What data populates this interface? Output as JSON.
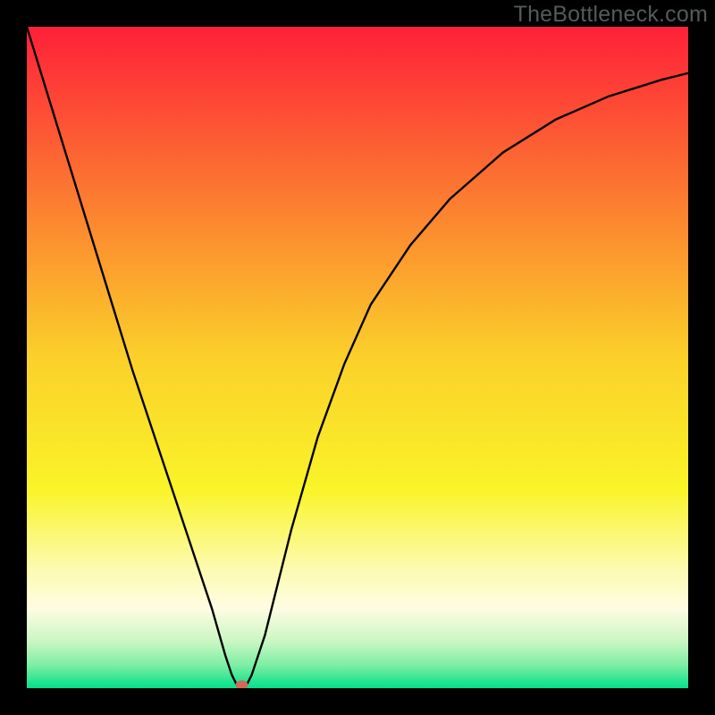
{
  "watermark": "TheBottleneck.com",
  "chart_data": {
    "type": "line",
    "title": "",
    "xlabel": "",
    "ylabel": "",
    "xlim": [
      0,
      100
    ],
    "ylim": [
      0,
      100
    ],
    "grid": false,
    "legend": false,
    "background_gradient": {
      "stops": [
        {
          "pos": 0.0,
          "color": "#fe2038"
        },
        {
          "pos": 0.25,
          "color": "#fc7831"
        },
        {
          "pos": 0.5,
          "color": "#fbd02a"
        },
        {
          "pos": 0.7,
          "color": "#faf428"
        },
        {
          "pos": 0.82,
          "color": "#fcfbb0"
        },
        {
          "pos": 0.88,
          "color": "#fefce2"
        },
        {
          "pos": 0.93,
          "color": "#c8f7c2"
        },
        {
          "pos": 0.965,
          "color": "#7eeea4"
        },
        {
          "pos": 1.0,
          "color": "#03e08a"
        }
      ]
    },
    "series": [
      {
        "name": "bottleneck-curve",
        "color": "#000000",
        "x": [
          0,
          4,
          8,
          12,
          16,
          20,
          24,
          28,
          30,
          31,
          32,
          33,
          34,
          36,
          38,
          40,
          44,
          48,
          52,
          58,
          64,
          72,
          80,
          88,
          96,
          100
        ],
        "y": [
          100,
          87,
          74,
          61,
          48,
          36,
          24,
          12,
          5,
          2,
          0,
          0,
          2,
          8,
          16,
          24,
          38,
          49,
          58,
          67,
          74,
          81,
          86,
          89.5,
          92,
          93
        ]
      }
    ],
    "markers": [
      {
        "name": "nadir-marker",
        "x": 32.5,
        "y": 0.5,
        "rx": 7,
        "ry": 5,
        "color": "#cf6a5a"
      }
    ]
  }
}
